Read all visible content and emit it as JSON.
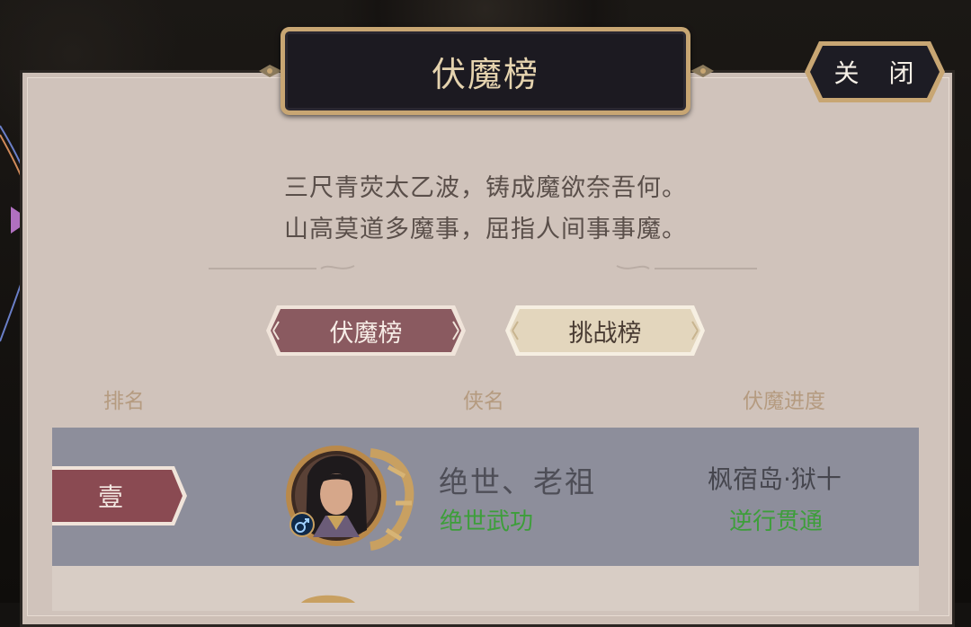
{
  "window": {
    "title": "伏魔榜"
  },
  "close_button": {
    "label": "关 闭"
  },
  "poem": {
    "line1": "三尺青荧太乙波，铸成魔欲奈吾何。",
    "line2": "山高莫道多魔事，屈指人间事事魔。"
  },
  "tabs": [
    {
      "label": "伏魔榜",
      "active": true
    },
    {
      "label": "挑战榜",
      "active": false
    }
  ],
  "columns": {
    "rank": "排名",
    "hero": "侠名",
    "progress": "伏魔进度"
  },
  "entries": [
    {
      "rank": "壹",
      "name": "绝世、老祖",
      "title": "绝世武功",
      "location": "枫宿岛·狱十",
      "status": "逆行贯通",
      "gender_icon": "male-icon"
    }
  ],
  "colors": {
    "active_tab": "#8a5a60",
    "inactive_tab": "#e8dcc4",
    "gold_trim": "#c8a673",
    "highlight_green": "#3d9e3a",
    "row_bg": "#8d8e9b"
  }
}
